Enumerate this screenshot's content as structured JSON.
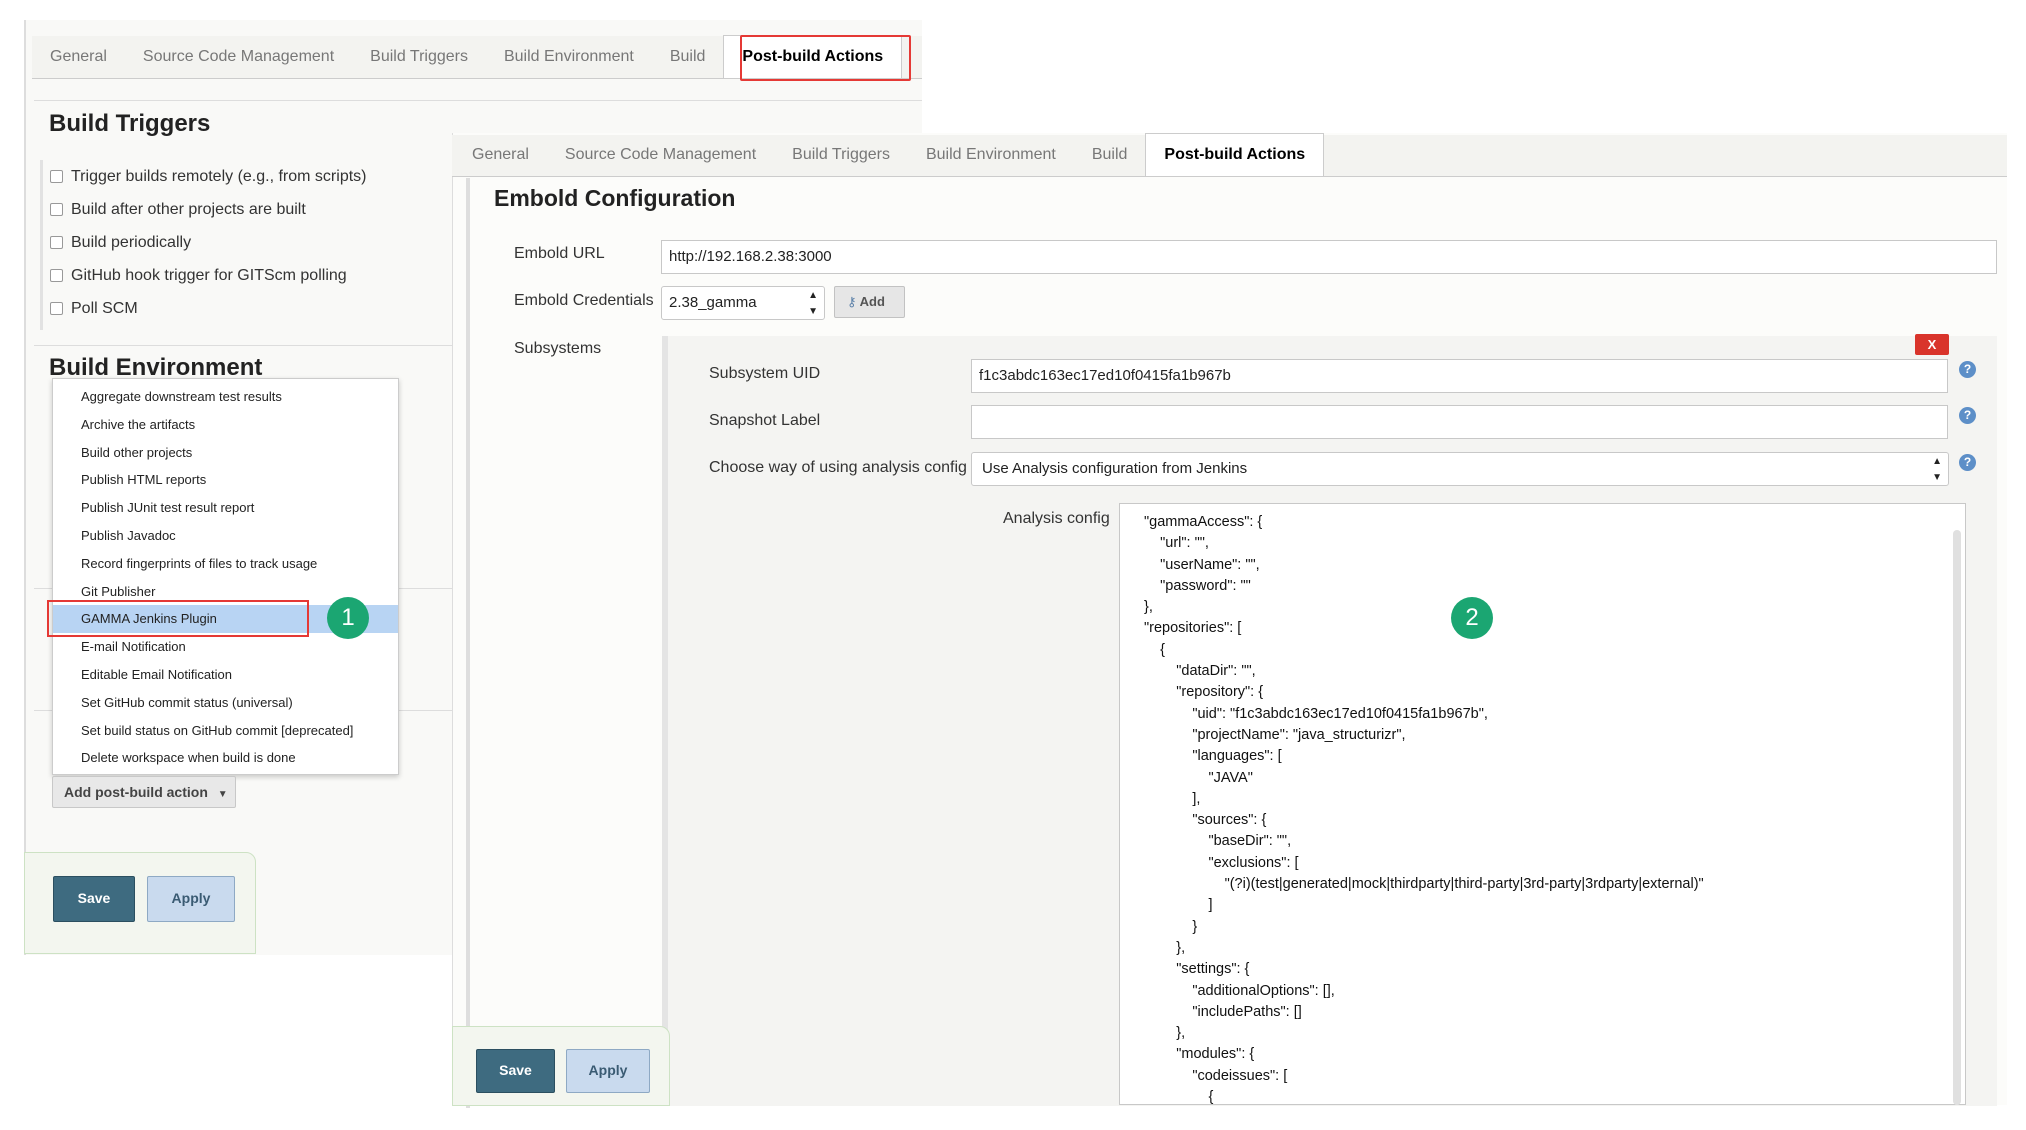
{
  "back": {
    "tabs": [
      "General",
      "Source Code Management",
      "Build Triggers",
      "Build Environment",
      "Build",
      "Post-build Actions"
    ],
    "active_tab": "Post-build Actions",
    "build_triggers_heading": "Build Triggers",
    "triggers": [
      "Trigger builds remotely (e.g., from scripts)",
      "Build after other projects are built",
      "Build periodically",
      "GitHub hook trigger for GITScm polling",
      "Poll SCM"
    ],
    "build_environment_heading": "Build Environment",
    "menu_items": [
      "Aggregate downstream test results",
      "Archive the artifacts",
      "Build other projects",
      "Publish HTML reports",
      "Publish JUnit test result report",
      "Publish Javadoc",
      "Record fingerprints of files to track usage",
      "Git Publisher",
      "GAMMA Jenkins Plugin",
      "E-mail Notification",
      "Editable Email Notification",
      "Set GitHub commit status (universal)",
      "Set build status on GitHub commit [deprecated]",
      "Delete workspace when build is done"
    ],
    "selected_item": "GAMMA Jenkins Plugin",
    "add_button": "Add post-build action",
    "save": "Save",
    "apply": "Apply",
    "step_badge": "1"
  },
  "front": {
    "tabs": [
      "General",
      "Source Code Management",
      "Build Triggers",
      "Build Environment",
      "Build",
      "Post-build Actions"
    ],
    "active_tab": "Post-build Actions",
    "section_title": "Embold Configuration",
    "url_label": "Embold URL",
    "url_value": "http://192.168.2.38:3000",
    "cred_label": "Embold Credentials",
    "cred_value": "2.38_gamma",
    "add_button": "Add",
    "subsystems_label": "Subsystems",
    "delete_button": "X",
    "uid_label": "Subsystem UID",
    "uid_value": "f1c3abdc163ec17ed10f0415fa1b967b",
    "snapshot_label": "Snapshot Label",
    "snapshot_value": "",
    "config_mode_label": "Choose way of using analysis config",
    "config_mode_value": "Use Analysis configuration from Jenkins",
    "analysis_label": "Analysis config",
    "analysis_lines": [
      "\"gammaAccess\": {",
      "    \"url\": \"\",",
      "    \"userName\": \"\",",
      "    \"password\": \"\"",
      "},",
      "\"repositories\": [",
      "    {",
      "        \"dataDir\": \"\",",
      "        \"repository\": {",
      "            \"uid\": \"f1c3abdc163ec17ed10f0415fa1b967b\",",
      "            \"projectName\": \"java_structurizr\",",
      "            \"languages\": [",
      "                \"JAVA\"",
      "            ],",
      "            \"sources\": {",
      "                \"baseDir\": \"\",",
      "                \"exclusions\": [",
      "                    \"(?i)(test|generated|mock|thirdparty|third-party|3rd-party|3rdparty|external)\"",
      "                ]",
      "            }",
      "        },",
      "        \"settings\": {",
      "            \"additionalOptions\": [],",
      "            \"includePaths\": []",
      "        },",
      "        \"modules\": {",
      "            \"codeissues\": [",
      "                {"
    ],
    "help_icon": "?",
    "save": "Save",
    "apply": "Apply",
    "step_badge": "2"
  },
  "colors": {
    "highlight_red": "#e53935",
    "badge_green": "#1ba672",
    "save_blue": "#3e6b80",
    "apply_blue": "#c9daee",
    "selected_item": "#b8d4f3"
  }
}
